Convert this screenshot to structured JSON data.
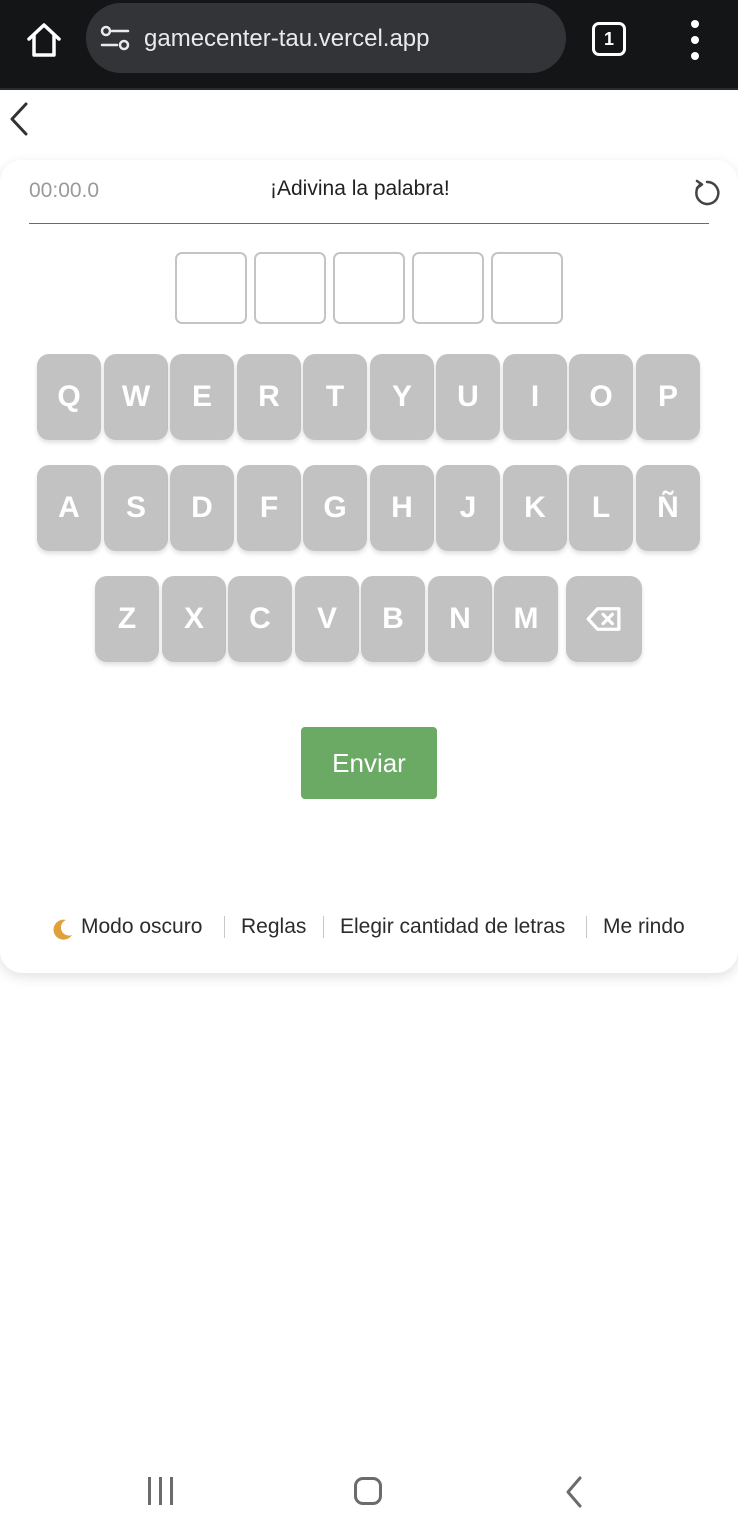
{
  "browser": {
    "url": "gamecenter-tau.vercel.app",
    "tab_count": "1"
  },
  "game": {
    "timer": "00:00.0",
    "title": "¡Adivina la palabra!",
    "slot_count": 5,
    "keyboard": {
      "row1": [
        "Q",
        "W",
        "E",
        "R",
        "T",
        "Y",
        "U",
        "I",
        "O",
        "P"
      ],
      "row2": [
        "A",
        "S",
        "D",
        "F",
        "G",
        "H",
        "J",
        "K",
        "L",
        "Ñ"
      ],
      "row3": [
        "Z",
        "X",
        "C",
        "V",
        "B",
        "N",
        "M"
      ]
    },
    "submit_label": "Enviar"
  },
  "footer": {
    "dark_mode": "Modo oscuro",
    "rules": "Reglas",
    "letter_count": "Elegir cantidad de letras",
    "give_up": "Me rindo"
  },
  "icons": {
    "home": "home-icon",
    "site_info": "site-settings-icon",
    "menu": "more-vert-icon",
    "back": "chevron-left-icon",
    "reset": "restart-icon",
    "backspace": "backspace-icon",
    "moon": "crescent-moon-icon"
  },
  "colors": {
    "key": "#c2c2c2",
    "submit": "#6aaa64",
    "browser_bar": "#141516"
  }
}
